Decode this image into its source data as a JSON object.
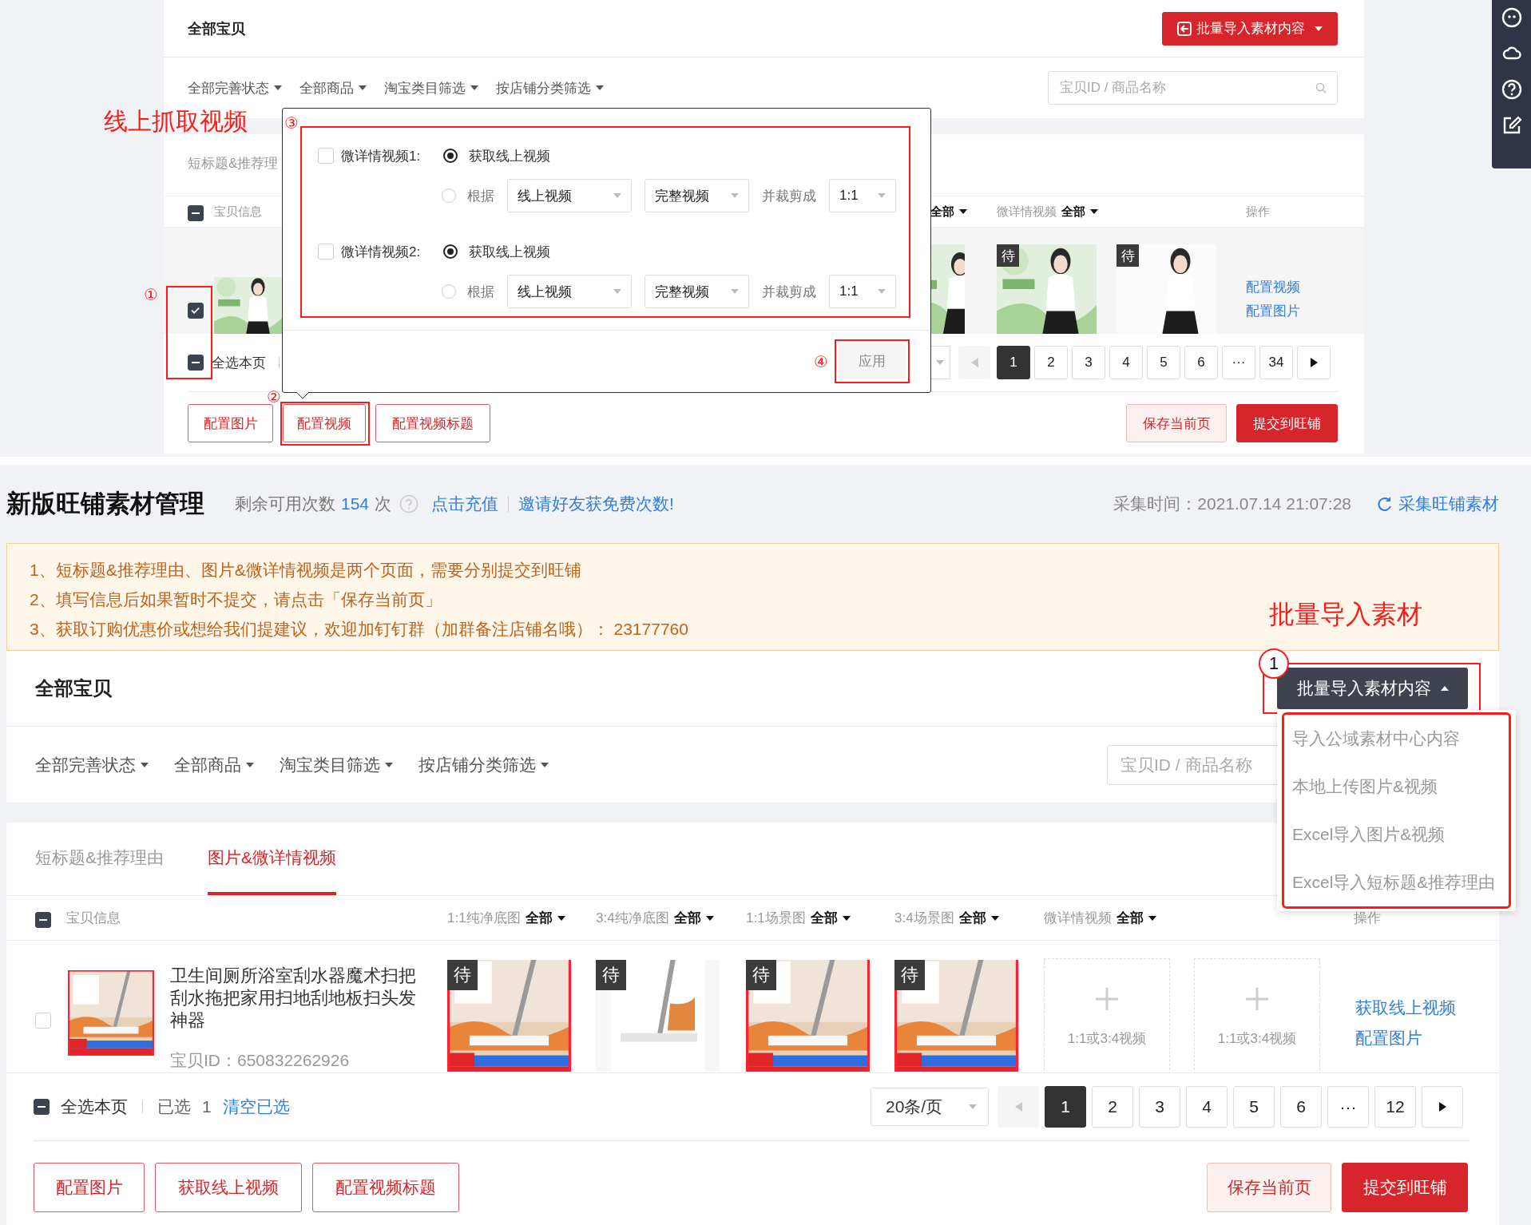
{
  "top": {
    "annotation": "线上抓取视频",
    "markers": [
      "①",
      "②",
      "③",
      "④"
    ],
    "header": {
      "title": "全部宝贝",
      "import_button": "批量导入素材内容",
      "expanded": false
    },
    "filters": [
      "全部完善状态",
      "全部商品",
      "淘宝类目筛选",
      "按店铺分类筛选"
    ],
    "search": {
      "placeholder": "宝贝ID / 商品名称"
    },
    "tabs": [
      {
        "label": "短标题&推荐理",
        "selected": false
      }
    ],
    "table_header": {
      "indeterminate": true
    },
    "columns": [
      {
        "label": "宝贝信息"
      },
      {
        "filter": "全部"
      },
      {
        "label": "微详情视频",
        "filter": "全部"
      },
      {
        "label": "操作"
      }
    ],
    "row": {
      "checked": true,
      "thumbnail": {
        "kind": "picture"
      },
      "media": [
        {
          "kind": "picture"
        },
        {
          "kind": "picture",
          "badge": "待"
        },
        {
          "kind": "picture",
          "badge": "待"
        }
      ],
      "actions": [
        "配置视频",
        "配置图片"
      ]
    },
    "footer": {
      "indeterminate": true,
      "select_all": "全选本页"
    },
    "pagination": {
      "prev_disabled": true,
      "pages": [
        {
          "label": "1",
          "selected": true
        },
        {
          "label": "2",
          "selected": false
        },
        {
          "label": "3",
          "selected": false
        },
        {
          "label": "4",
          "selected": false
        },
        {
          "label": "5",
          "selected": false
        },
        {
          "label": "6",
          "selected": false
        },
        {
          "label": "···",
          "selected": false
        },
        {
          "label": "34",
          "selected": false
        }
      ]
    },
    "buttons": [
      "配置图片",
      "配置视频",
      "配置视频标题"
    ],
    "save": "保存当前页",
    "submit": "提交到旺铺",
    "popover": {
      "blocks": [
        {
          "checked": false,
          "label": "微详情视频1:",
          "options": [
            {
              "label": "获取线上视频",
              "selected": true
            },
            {
              "label": "根据",
              "selected": false
            }
          ],
          "source": "线上视频",
          "length": "完整视频",
          "crop_label": "并裁剪成",
          "ratio": "1:1"
        },
        {
          "checked": false,
          "label": "微详情视频2:",
          "options": [
            {
              "label": "获取线上视频",
              "selected": true
            },
            {
              "label": "根据",
              "selected": false
            }
          ],
          "source": "线上视频",
          "length": "完整视频",
          "crop_label": "并裁剪成",
          "ratio": "1:1"
        }
      ],
      "apply": {
        "label": "应用",
        "disabled": true
      }
    }
  },
  "bottom": {
    "title": "新版旺铺素材管理",
    "quota": {
      "label": "剩余可用次数",
      "count": "154",
      "unit": "次"
    },
    "recharge": "点击充值",
    "invite": "邀请好友获免费次数!",
    "collect_time": "采集时间：2021.07.14 21:07:28",
    "collect": "采集旺铺素材",
    "notices": [
      "1、短标题&推荐理由、图片&微详情视频是两个页面，需要分别提交到旺铺",
      "2、填写信息后如果暂时不提交，请点击「保存当前页」",
      "3、获取订购优惠价或想给我们提建议，欢迎加钉钉群（加群备注店铺名哦）： 23177760"
    ],
    "annotation": "批量导入素材",
    "marker": "1",
    "header": {
      "title": "全部宝贝",
      "import_button": "批量导入素材内容",
      "expanded": true
    },
    "import_menu": [
      "导入公域素材中心内容",
      "本地上传图片&视频",
      "Excel导入图片&视频",
      "Excel导入短标题&推荐理由"
    ],
    "filters": [
      "全部完善状态",
      "全部商品",
      "淘宝类目筛选",
      "按店铺分类筛选"
    ],
    "search": {
      "placeholder": "宝贝ID / 商品名称"
    },
    "tabs": [
      {
        "label": "短标题&推荐理由",
        "selected": false
      },
      {
        "label": "图片&微详情视频",
        "selected": true
      }
    ],
    "table_header": {
      "indeterminate": true
    },
    "columns": [
      {
        "label": "宝贝信息"
      },
      {
        "label": "1:1纯净底图",
        "filter": "全部"
      },
      {
        "label": "3:4纯净底图",
        "filter": "全部"
      },
      {
        "label": "1:1场景图",
        "filter": "全部"
      },
      {
        "label": "3:4场景图",
        "filter": "全部"
      },
      {
        "label": "微详情视频",
        "filter": "全部"
      },
      {
        "label": "操作"
      }
    ],
    "row": {
      "checked": false,
      "thumbnail": {
        "kind": "picture"
      },
      "title": "卫生间厕所浴室刮水器魔术扫把刮水拖把家用扫地刮地板扫头发神器",
      "item_id": "宝贝ID：650832262926",
      "media": [
        {
          "kind": "picture",
          "badge": "待"
        },
        {
          "kind": "picture",
          "badge": "待"
        },
        {
          "kind": "picture",
          "badge": "待"
        },
        {
          "kind": "picture",
          "badge": "待"
        },
        {
          "kind": "slot",
          "hint": "1:1或3:4视频"
        },
        {
          "kind": "slot",
          "hint": "1:1或3:4视频"
        }
      ],
      "actions": [
        "获取线上视频",
        "配置图片"
      ]
    },
    "footer": {
      "indeterminate": true,
      "select_all": "全选本页",
      "selected_label": "已选",
      "selected_count": "1",
      "clear": "清空已选",
      "page_size": "20条/页"
    },
    "pagination": {
      "prev_disabled": true,
      "pages": [
        {
          "label": "1",
          "selected": true
        },
        {
          "label": "2",
          "selected": false
        },
        {
          "label": "3",
          "selected": false
        },
        {
          "label": "4",
          "selected": false
        },
        {
          "label": "5",
          "selected": false
        },
        {
          "label": "6",
          "selected": false
        },
        {
          "label": "···",
          "selected": false
        },
        {
          "label": "12",
          "selected": false
        }
      ]
    },
    "buttons": [
      "配置图片",
      "获取线上视频",
      "配置视频标题"
    ],
    "save": "保存当前页",
    "submit": "提交到旺铺"
  }
}
